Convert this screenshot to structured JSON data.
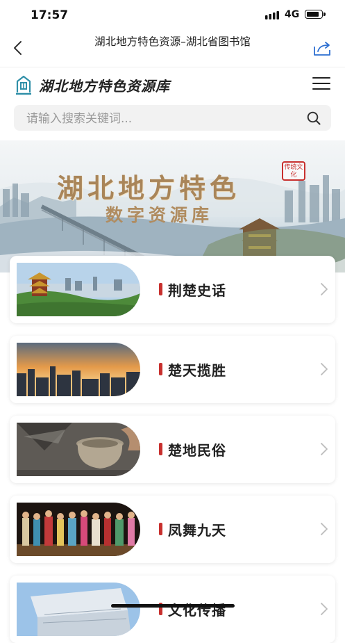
{
  "status": {
    "time": "17:57",
    "network": "4G",
    "battery_level": 0.85
  },
  "navbar": {
    "title": "湖北地方特色资源–湖北省图书馆",
    "back_icon": "chevron-left-icon",
    "share_icon": "share-icon"
  },
  "site": {
    "name": "湖北地方特色资源库",
    "menu_icon": "hamburger-icon",
    "logo_icon": "library-logo-icon"
  },
  "search": {
    "placeholder": "请输入搜索关键词...",
    "value": "",
    "icon": "search-icon"
  },
  "banner": {
    "title": "湖北地方特色",
    "subtitle": "数字资源库",
    "seal": "传统文化"
  },
  "cards": [
    {
      "label": "荆楚史话",
      "accent": "#c8302e"
    },
    {
      "label": "楚天揽胜",
      "accent": "#c8302e"
    },
    {
      "label": "楚地民俗",
      "accent": "#c8302e"
    },
    {
      "label": "凤舞九天",
      "accent": "#c8302e"
    },
    {
      "label": "文化传播",
      "accent": "#c8302e"
    }
  ]
}
